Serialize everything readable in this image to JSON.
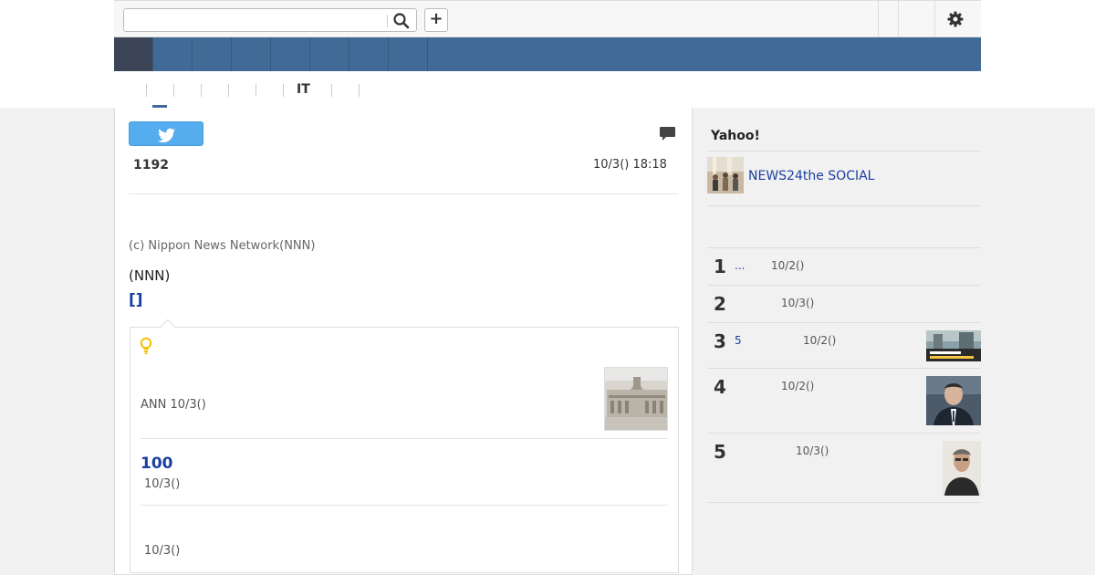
{
  "colors": {
    "nav_bar": "#426a96",
    "nav_active": "#3c4556",
    "link": "#1a3fa0",
    "tweet": "#55acee"
  },
  "header": {
    "search_placeholder": "",
    "search_icon": "search-icon",
    "add_icon": "plus-icon",
    "add_label": "+",
    "settings_icon": "gear-icon"
  },
  "subnav": {
    "items": [
      "IT"
    ]
  },
  "article": {
    "share_icon": "twitter-icon",
    "comment_icon": "comment-icon",
    "count": "1192",
    "date": "10/3() 18:18",
    "copyright": "(c) Nippon News Network(NNN)",
    "nnn": "(NNN)",
    "link_brackets": "[]"
  },
  "related": {
    "tip_icon": "lightbulb-icon",
    "items": [
      {
        "source": "ANN 10/3()"
      },
      {
        "number": "100",
        "date": "10/3()"
      },
      {
        "date": "10/3()"
      }
    ]
  },
  "sidebar": {
    "title": "Yahoo!",
    "feature_link": "NEWS24the SOCIAL",
    "ranking": [
      {
        "rank": "1",
        "text": "...",
        "date": "10/2()"
      },
      {
        "rank": "2",
        "text": "",
        "date": "10/3()"
      },
      {
        "rank": "3",
        "text": "5",
        "date": "10/2()"
      },
      {
        "rank": "4",
        "text": "",
        "date": "10/2()"
      },
      {
        "rank": "5",
        "text": "",
        "date": "10/3()"
      }
    ]
  }
}
